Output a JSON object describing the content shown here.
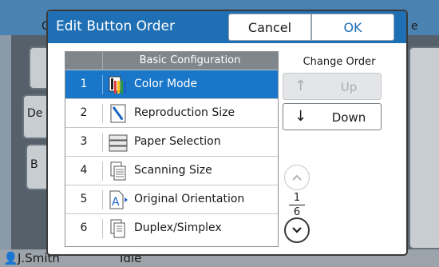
{
  "background": {
    "user": "J.Smith",
    "status": "Idle",
    "fragments": [
      "C",
      "De",
      "B",
      "e"
    ]
  },
  "dialog": {
    "title": "Edit Button Order",
    "cancel_label": "Cancel",
    "ok_label": "OK"
  },
  "list": {
    "header": "Basic Configuration",
    "selected_index": 0,
    "rows": [
      {
        "num": "1",
        "label": "Color Mode",
        "icon": "color-mode-icon"
      },
      {
        "num": "2",
        "label": "Reproduction Size",
        "icon": "reproduction-size-icon"
      },
      {
        "num": "3",
        "label": "Paper Selection",
        "icon": "paper-selection-icon"
      },
      {
        "num": "4",
        "label": "Scanning Size",
        "icon": "scanning-size-icon"
      },
      {
        "num": "5",
        "label": "Original Orientation",
        "icon": "original-orientation-icon"
      },
      {
        "num": "6",
        "label": "Duplex/Simplex",
        "icon": "duplex-simplex-icon"
      }
    ]
  },
  "change_order": {
    "label": "Change Order",
    "up_label": "Up",
    "down_label": "Down",
    "up_enabled": false
  },
  "pager": {
    "current": "1",
    "total": "6"
  }
}
